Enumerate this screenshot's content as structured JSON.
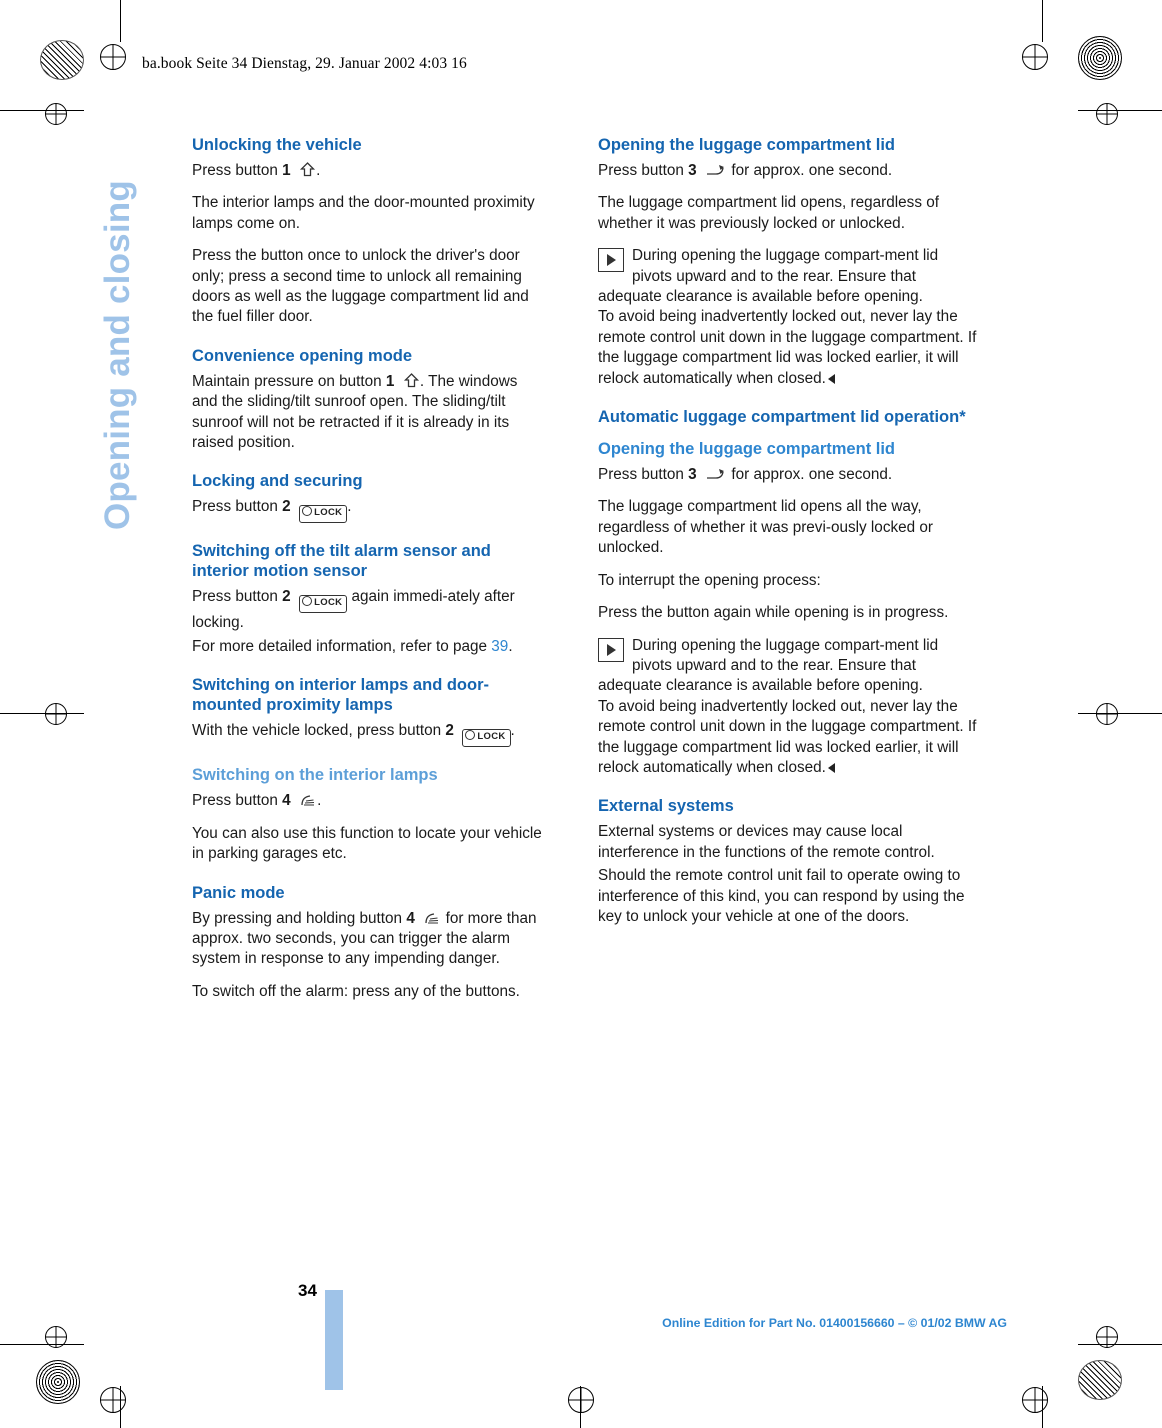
{
  "header": {
    "file_line": "ba.book  Seite 34  Dienstag, 29. Januar 2002  4:03 16"
  },
  "chapter": {
    "title": "Opening and closing"
  },
  "footer": {
    "page_number": "34",
    "online_edition": "Online Edition for Part No. 01400156660 – © 01/02 BMW AG"
  },
  "left_column": {
    "s1": {
      "heading": "Unlocking the vehicle",
      "p1_pre": "Press button ",
      "p1_num": "1",
      "p1_post": ".",
      "p2": "The interior lamps and the door-mounted proximity lamps come on.",
      "p3": "Press the button once to unlock the driver's door only; press a second time to unlock all remaining doors as well as the luggage compartment lid and the fuel filler door."
    },
    "s2": {
      "heading": "Convenience opening mode",
      "p1_pre": "Maintain pressure on button ",
      "p1_num": "1",
      "p1_post": ". The windows and the sliding/tilt sunroof open. The sliding/tilt sunroof will not be retracted if it is already in its raised position."
    },
    "s3": {
      "heading": "Locking and securing",
      "p1_pre": "Press button ",
      "p1_num": "2",
      "p1_post": "."
    },
    "s4": {
      "heading": "Switching off the tilt alarm sensor and interior motion sensor",
      "p1_pre": "Press button ",
      "p1_num": "2",
      "p1_post": " again immedi-ately after locking.",
      "p2_pre": "For more detailed information, refer to page ",
      "p2_ref": "39",
      "p2_post": "."
    },
    "s5": {
      "heading": "Switching on interior lamps and door-mounted proximity lamps",
      "p1_pre": "With the vehicle locked, press button ",
      "p1_num": "2",
      "p1_post": "."
    },
    "s6": {
      "heading": "Switching on the interior lamps",
      "p1_pre": "Press button ",
      "p1_num": "4",
      "p1_post": ".",
      "p2": "You can also use this function to locate your vehicle in parking garages etc."
    },
    "s7": {
      "heading": "Panic mode",
      "p1_pre": "By pressing and holding button ",
      "p1_num": "4",
      "p1_post": " for more than approx. two seconds, you can trigger the alarm system in response to any impending danger.",
      "p2": "To switch off the alarm: press any of the buttons."
    }
  },
  "right_column": {
    "s1": {
      "heading": "Opening the luggage compartment lid",
      "p1_pre": "Press button ",
      "p1_num": "3",
      "p1_post": " for approx. one second.",
      "p2": "The luggage compartment lid opens, regardless of whether it was previously locked or unlocked.",
      "note1_strong": "During opening the luggage compart-ment lid pivots upward and to the ",
      "note1_rest": "rear. Ensure that adequate clearance is available before opening.",
      "note1_tail": "To avoid being inadvertently locked out, never lay the remote control unit down in the luggage compartment. If the luggage compartment lid was locked earlier, it will relock automatically when closed."
    },
    "s2": {
      "heading": "Automatic luggage compartment lid operation*",
      "sub_heading": "Opening the luggage compartment lid",
      "p1_pre": "Press button ",
      "p1_num": "3",
      "p1_post": " for approx. one second.",
      "p2": "The luggage compartment lid opens all the way, regardless of whether it was previ-ously locked or unlocked.",
      "p3": "To interrupt the opening process:",
      "p4": "Press the button again while opening is in progress.",
      "note1_strong": "During opening the luggage compart-ment lid pivots upward and to the ",
      "note1_rest": "rear. Ensure that adequate clearance is available before opening.",
      "note1_tail": "To avoid being inadvertently locked out, never lay the remote control unit down in the luggage compartment. If the luggage compartment lid was locked earlier, it will relock automatically when closed."
    },
    "s3": {
      "heading": "External systems",
      "p1": "External systems or devices may cause local interference in the functions of the remote control.",
      "p2": "Should the remote control unit fail to operate owing to interference of this kind, you can respond by using the key to unlock your vehicle at one of the doors."
    }
  },
  "icons": {
    "unlock": "unlock-icon",
    "lock_label": "LOCK",
    "lamp": "interior-lamp-icon",
    "trunk": "trunk-release-icon",
    "note_arrow": "note-arrow-icon"
  },
  "colors": {
    "heading_blue": "#1565b0",
    "light_blue": "#9fc3e8",
    "link_blue": "#2e86d0"
  }
}
